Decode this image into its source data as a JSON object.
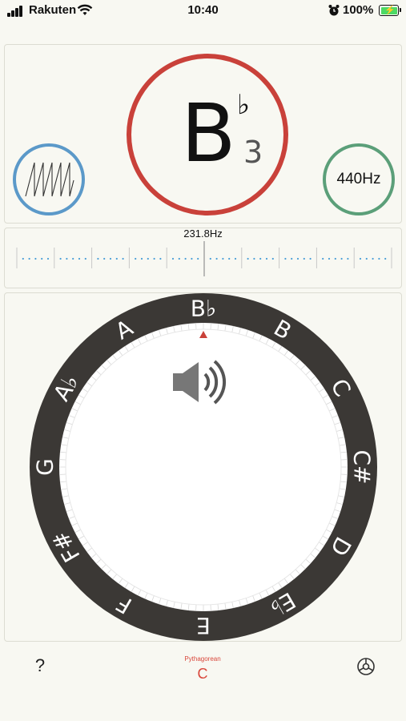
{
  "status_bar": {
    "carrier": "Rakuten",
    "time": "10:40",
    "battery_percent": "100%",
    "battery_level": 1.0,
    "icons": [
      "signal-icon",
      "wifi-icon",
      "alarm-icon",
      "battery-charging-icon"
    ]
  },
  "note_display": {
    "letter": "B",
    "accidental": "♭",
    "octave": "3",
    "ring_color": "#c9413a"
  },
  "waveform_button": {
    "icon": "sawtooth-wave-icon",
    "color": "#5b99c9"
  },
  "pitch_button": {
    "label": "440Hz",
    "color": "#5b9f79"
  },
  "meter": {
    "frequency_label": "231.8Hz",
    "dot_color": "#4a9fd8",
    "needle_color": "#aaaaaa"
  },
  "dial": {
    "notes": [
      "B♭",
      "B",
      "C",
      "C#",
      "D",
      "E♭",
      "E",
      "F",
      "F#",
      "G",
      "A♭",
      "A"
    ],
    "selected_note": "B♭",
    "ring_color": "#3b3835",
    "marker_color": "#c9413a",
    "speaker_icon": "speaker-sound-icon"
  },
  "bottom_bar": {
    "help_label": "?",
    "temperament_name": "Pythagorean",
    "temperament_key": "C",
    "accent_color": "#d9473b",
    "settings_icon": "gear-icon"
  }
}
